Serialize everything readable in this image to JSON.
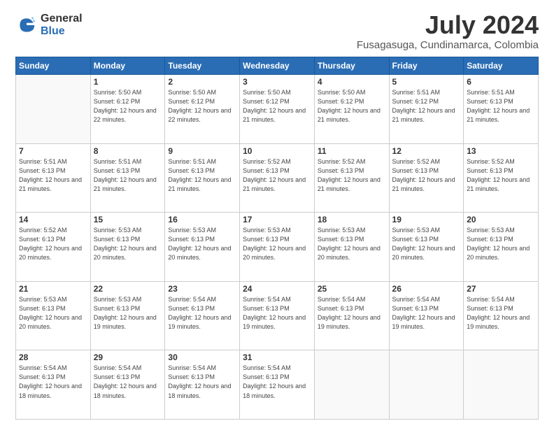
{
  "logo": {
    "general": "General",
    "blue": "Blue"
  },
  "header": {
    "month_year": "July 2024",
    "location": "Fusagasuga, Cundinamarca, Colombia"
  },
  "weekdays": [
    "Sunday",
    "Monday",
    "Tuesday",
    "Wednesday",
    "Thursday",
    "Friday",
    "Saturday"
  ],
  "weeks": [
    [
      {
        "day": "",
        "sunrise": "",
        "sunset": "",
        "daylight": ""
      },
      {
        "day": "1",
        "sunrise": "5:50 AM",
        "sunset": "6:12 PM",
        "daylight": "12 hours and 22 minutes."
      },
      {
        "day": "2",
        "sunrise": "5:50 AM",
        "sunset": "6:12 PM",
        "daylight": "12 hours and 22 minutes."
      },
      {
        "day": "3",
        "sunrise": "5:50 AM",
        "sunset": "6:12 PM",
        "daylight": "12 hours and 21 minutes."
      },
      {
        "day": "4",
        "sunrise": "5:50 AM",
        "sunset": "6:12 PM",
        "daylight": "12 hours and 21 minutes."
      },
      {
        "day": "5",
        "sunrise": "5:51 AM",
        "sunset": "6:12 PM",
        "daylight": "12 hours and 21 minutes."
      },
      {
        "day": "6",
        "sunrise": "5:51 AM",
        "sunset": "6:13 PM",
        "daylight": "12 hours and 21 minutes."
      }
    ],
    [
      {
        "day": "7",
        "sunrise": "5:51 AM",
        "sunset": "6:13 PM",
        "daylight": "12 hours and 21 minutes."
      },
      {
        "day": "8",
        "sunrise": "5:51 AM",
        "sunset": "6:13 PM",
        "daylight": "12 hours and 21 minutes."
      },
      {
        "day": "9",
        "sunrise": "5:51 AM",
        "sunset": "6:13 PM",
        "daylight": "12 hours and 21 minutes."
      },
      {
        "day": "10",
        "sunrise": "5:52 AM",
        "sunset": "6:13 PM",
        "daylight": "12 hours and 21 minutes."
      },
      {
        "day": "11",
        "sunrise": "5:52 AM",
        "sunset": "6:13 PM",
        "daylight": "12 hours and 21 minutes."
      },
      {
        "day": "12",
        "sunrise": "5:52 AM",
        "sunset": "6:13 PM",
        "daylight": "12 hours and 21 minutes."
      },
      {
        "day": "13",
        "sunrise": "5:52 AM",
        "sunset": "6:13 PM",
        "daylight": "12 hours and 21 minutes."
      }
    ],
    [
      {
        "day": "14",
        "sunrise": "5:52 AM",
        "sunset": "6:13 PM",
        "daylight": "12 hours and 20 minutes."
      },
      {
        "day": "15",
        "sunrise": "5:53 AM",
        "sunset": "6:13 PM",
        "daylight": "12 hours and 20 minutes."
      },
      {
        "day": "16",
        "sunrise": "5:53 AM",
        "sunset": "6:13 PM",
        "daylight": "12 hours and 20 minutes."
      },
      {
        "day": "17",
        "sunrise": "5:53 AM",
        "sunset": "6:13 PM",
        "daylight": "12 hours and 20 minutes."
      },
      {
        "day": "18",
        "sunrise": "5:53 AM",
        "sunset": "6:13 PM",
        "daylight": "12 hours and 20 minutes."
      },
      {
        "day": "19",
        "sunrise": "5:53 AM",
        "sunset": "6:13 PM",
        "daylight": "12 hours and 20 minutes."
      },
      {
        "day": "20",
        "sunrise": "5:53 AM",
        "sunset": "6:13 PM",
        "daylight": "12 hours and 20 minutes."
      }
    ],
    [
      {
        "day": "21",
        "sunrise": "5:53 AM",
        "sunset": "6:13 PM",
        "daylight": "12 hours and 20 minutes."
      },
      {
        "day": "22",
        "sunrise": "5:53 AM",
        "sunset": "6:13 PM",
        "daylight": "12 hours and 19 minutes."
      },
      {
        "day": "23",
        "sunrise": "5:54 AM",
        "sunset": "6:13 PM",
        "daylight": "12 hours and 19 minutes."
      },
      {
        "day": "24",
        "sunrise": "5:54 AM",
        "sunset": "6:13 PM",
        "daylight": "12 hours and 19 minutes."
      },
      {
        "day": "25",
        "sunrise": "5:54 AM",
        "sunset": "6:13 PM",
        "daylight": "12 hours and 19 minutes."
      },
      {
        "day": "26",
        "sunrise": "5:54 AM",
        "sunset": "6:13 PM",
        "daylight": "12 hours and 19 minutes."
      },
      {
        "day": "27",
        "sunrise": "5:54 AM",
        "sunset": "6:13 PM",
        "daylight": "12 hours and 19 minutes."
      }
    ],
    [
      {
        "day": "28",
        "sunrise": "5:54 AM",
        "sunset": "6:13 PM",
        "daylight": "12 hours and 18 minutes."
      },
      {
        "day": "29",
        "sunrise": "5:54 AM",
        "sunset": "6:13 PM",
        "daylight": "12 hours and 18 minutes."
      },
      {
        "day": "30",
        "sunrise": "5:54 AM",
        "sunset": "6:13 PM",
        "daylight": "12 hours and 18 minutes."
      },
      {
        "day": "31",
        "sunrise": "5:54 AM",
        "sunset": "6:13 PM",
        "daylight": "12 hours and 18 minutes."
      },
      {
        "day": "",
        "sunrise": "",
        "sunset": "",
        "daylight": ""
      },
      {
        "day": "",
        "sunrise": "",
        "sunset": "",
        "daylight": ""
      },
      {
        "day": "",
        "sunrise": "",
        "sunset": "",
        "daylight": ""
      }
    ]
  ]
}
